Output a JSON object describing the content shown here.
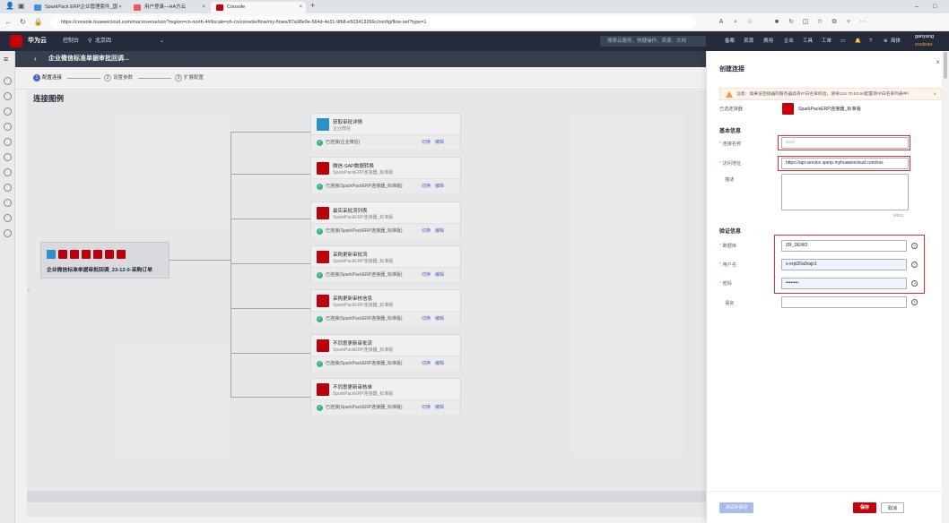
{
  "browser": {
    "tabs": [
      {
        "label": "SparkPack ERP企业管理套件_国 ×",
        "active": false,
        "icon_color": "#4a90d9"
      },
      {
        "label": "用户登录—HA方云",
        "active": false,
        "icon_color": "#e85b5b"
      },
      {
        "label": "Console",
        "active": true,
        "icon_color": "#c7000b"
      }
    ],
    "new_tab": "+",
    "url": "https://console.huaweicloud.com/macroverse/ssr/?region=cn-north-4#/locale=zh-cn/console/flow/my-flows/87a98e9e-564d-4e31-9fb8-e503413266c/config/flow-set?type=1",
    "win_controls": [
      "–",
      "□"
    ]
  },
  "header": {
    "brand": "华为云",
    "console": "控制台",
    "region": "北京四",
    "search_placeholder": "搜索云服务、快捷操作、资源、文档",
    "links": [
      "备案",
      "资源",
      "费用",
      "企业",
      "工具",
      "工单"
    ],
    "lang": "简体",
    "user_name": "ganyang",
    "user_sub": "zoutoan"
  },
  "page": {
    "title": "企业微信标准单据审批回调...",
    "heading": "连接图例",
    "steps": [
      {
        "num": "1",
        "label": "配置连接",
        "active": true
      },
      {
        "num": "2",
        "label": "设置参数",
        "active": false
      },
      {
        "num": "3",
        "label": "扩展配置",
        "active": false
      }
    ]
  },
  "source_node": {
    "label": "企业微信标准单据审批回调_23-12-0-采购订单"
  },
  "targets": [
    {
      "name": "获取审批详情",
      "sub": "企业微信",
      "status": "已连接(企业微信)",
      "logo": "blue",
      "switch": "切换",
      "edit": "编辑"
    },
    {
      "name": "微信-SAP数据转换",
      "sub": "SparkPackERP连接器_标准版",
      "status": "已连接(SparkPackERP连接器_标准版)",
      "logo": "red",
      "switch": "切换",
      "edit": "编辑"
    },
    {
      "name": "最实采批流列表",
      "sub": "SparkPackERP连接器_标准版",
      "status": "已连接(SparkPackERP连接器_标准版)",
      "logo": "red",
      "switch": "切换",
      "edit": "编辑"
    },
    {
      "name": "采购更新审批流",
      "sub": "SparkPackERP连接器_标准版",
      "status": "已连接(SparkPackERP连接器_标准版)",
      "logo": "red",
      "switch": "切换",
      "edit": "编辑"
    },
    {
      "name": "采购更新审核信息",
      "sub": "SparkPackERP连接器_标准版",
      "status": "已连接(SparkPackERP连接器_标准版)",
      "logo": "red",
      "switch": "切换",
      "edit": "编辑"
    },
    {
      "name": "不同意更新审批流",
      "sub": "SparkPackERP连接器_标准版",
      "status": "已连接(SparkPackERP连接器_标准版)",
      "logo": "red",
      "switch": "切换",
      "edit": "编辑"
    },
    {
      "name": "不同意更新审核单",
      "sub": "SparkPackERP连接器_标准版",
      "status": "已连接(SparkPackERP连接器_标准版)",
      "logo": "red",
      "switch": "切换",
      "edit": "编辑"
    }
  ],
  "drawer": {
    "title": "创建连接",
    "warning": "注意：如果该连接器的服务器具有IP白名单校验，请将124.70.83.64配置到IP白名单列表中！",
    "connector_label": "已选连接器",
    "connector_value": "SparkPackERP连接器_标准版",
    "basic_section": "基本信息",
    "conn_name_label": "连接名称",
    "conn_name_value": "xxxx",
    "access_label": "访问地址",
    "access_value": "https://api-service.sperp.myhuaweicloud.com/xxx",
    "desc_label": "描述",
    "desc_counter": "0/512",
    "auth_section": "验证信息",
    "db_label": "数据库",
    "db_value": "ZR_DEMO",
    "user_label": "用户名",
    "user_value": "s-erpl20a9rajo1",
    "pwd_label": "密码",
    "pwd_value": "••••••••",
    "lang_label": "语言",
    "lang_value": "",
    "btn_test": "测试并保存",
    "btn_save": "保存",
    "btn_cancel": "取消"
  },
  "colors": {
    "brand_red": "#c7000b",
    "header_bg": "#252b3a",
    "accent_blue": "#526ecc",
    "success_green": "#3ac295"
  }
}
